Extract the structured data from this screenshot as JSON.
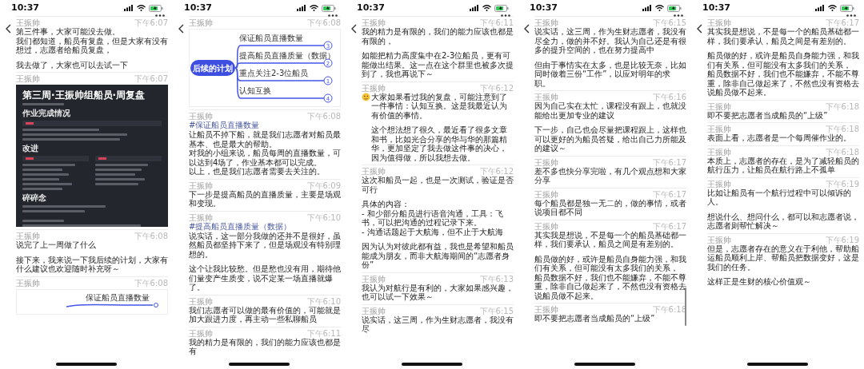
{
  "panels": [
    {
      "status": {
        "time": "10:37"
      },
      "messages": [
        {
          "kind": "text",
          "sender": "王振帅",
          "time": "下午6:07",
          "paragraphs": [
            [
              "第三件事，大家可能没去做。",
              "我们都知道，船员有复盘，但是大家有没有想过，志愿者给船员复盘，"
            ],
            [
              "我去做了，大家也可以去试一下"
            ]
          ]
        },
        {
          "kind": "document",
          "sender": "王振帅",
          "time": "下午6:07",
          "document": {
            "title": "第三周·王振帅组船员·周复盘",
            "sections": [
              {
                "heading": "作业完成情况",
                "kind": "single"
              },
              {
                "heading": "改进",
                "kind": "double"
              },
              {
                "heading": "碎碎念",
                "kind": "plain"
              }
            ]
          }
        },
        {
          "kind": "text",
          "sender": "王振帅",
          "time": "下午6:08",
          "paragraphs": [
            [
              "说完了上一周做了什么"
            ],
            [
              "接下来，我来说一下我后续的计划，大家有什么建议也欢迎随时补充呀～"
            ]
          ]
        },
        {
          "kind": "mindmap_preview",
          "sender": "王振帅",
          "time": "下午6:08",
          "label": "保证船员直播数量"
        }
      ]
    },
    {
      "status": {
        "time": "10:37"
      },
      "messages": [
        {
          "kind": "mindmap",
          "sender": "王振帅",
          "time": "下午6:08",
          "mindmap": {
            "center": "后续的计划",
            "branches": [
              {
                "label": "保证船员直播数量",
                "badge": "3"
              },
              {
                "label": "提高船员直播质量（数据）",
                "badge": "2"
              },
              {
                "label": "重点关注2-3位船员",
                "badge": "1"
              },
              {
                "label": "认知互换",
                "badge": "4"
              }
            ]
          }
        },
        {
          "kind": "topic",
          "sender": "王振帅",
          "time": "下午6:08",
          "hashtag": "#保证船员直播数量",
          "paragraphs": [
            [
              "让船员不掉下船，就是我们志愿者对船员最基本、也是最大的帮助。",
              "对我的小组来说，船员每周的直播数量，可以达到4场了，作业基本都可以完成。",
              "以上，也是我们志愿者需要去关注的。"
            ]
          ]
        },
        {
          "kind": "text",
          "sender": "王振帅",
          "time": "下午6:09",
          "paragraphs": [
            [
              "下一步是提高船员的直播质量，主要是场观和变现。"
            ]
          ]
        },
        {
          "kind": "topic",
          "sender": "王振帅",
          "time": "下午6:10",
          "hashtag": "#提高船员直播质量（数据）",
          "paragraphs": [
            [
              "说实话，这一部分我做的还并不是很好，虽然船员都坚持下来了，但是场观没有特别理想的。"
            ],
            [
              "这个让我比较愁。但是愁也没有用，期待他们量变产生质变，说不定某一场直播就爆了。"
            ]
          ]
        },
        {
          "kind": "text",
          "sender": "王振帅",
          "time": "下午6:10",
          "paragraphs": [
            [
              "我们志愿者可以做的最有价值的，可能就是加大跟进力度，再主动一些私聊船员"
            ]
          ]
        },
        {
          "kind": "text",
          "sender": "王振帅",
          "time": "下午6:11",
          "paragraphs": [
            [
              "我的精力是有限的，我们的能力应该也都是有"
            ]
          ]
        }
      ]
    },
    {
      "status": {
        "time": "10:37"
      },
      "messages": [
        {
          "kind": "text",
          "sender": "王振帅",
          "time": "下午6:11",
          "paragraphs": [
            [
              "我的精力是有限的，我们的能力应该也都是有限的，"
            ],
            [
              "如能把精力高度集中在2-3位船员，更有可能做出结果。这一点在这个群里也被多次提到了，我也再说下～"
            ]
          ]
        },
        {
          "kind": "text",
          "sender": "王振帅",
          "time": "下午6:12",
          "leading_emoji": true,
          "paragraphs": [
            [
              "大家如果看过我的复盘，可能注意到了一件事情：认知互换。这是我最近认为有价值的事情。"
            ],
            [
              "这个想法想了很久，最近看了很多文章和书，比如光合分享的华与华的那篇精华，更加坚定了我去做这件事的决心，因为值得做，所以我想去做。"
            ]
          ]
        },
        {
          "kind": "text",
          "sender": "王振帅",
          "time": "下午6:12",
          "paragraphs": [
            [
              "这次和船员一起，也是一次测试，验证是否可行"
            ],
            [
              "具体的内容：",
              "- 和少部分船员进行语音沟通，工具：飞书，可以把沟通的过程记录下来。",
              "- 沟通话题起于大航海，但不止于大航海"
            ],
            [
              "因为认为对彼此都有益，我也是希望和船员能成为朋友，而非大航海期间的“志愿者身份”"
            ]
          ]
        },
        {
          "kind": "text",
          "sender": "王振帅",
          "time": "下午6:13",
          "paragraphs": [
            [
              "我认为对航行是有利的，大家如果感兴趣，也可以试一下效果～"
            ]
          ]
        },
        {
          "kind": "text",
          "sender": "王振帅",
          "time": "下午6:15",
          "paragraphs": [
            [
              "说实话，这三周，作为生财志愿者，我没有尽"
            ]
          ]
        }
      ]
    },
    {
      "status": {
        "time": "10:37"
      },
      "show_scroll_indicator": true,
      "messages": [
        {
          "kind": "text",
          "sender": "王振帅",
          "time": "下午6:15",
          "paragraphs": [
            [
              "说实话，这三周，作为生财志愿者，我没有尽全力，做的并不好。我认为自己还是有很多的提升空间的，也在努力提高中"
            ],
            [
              "但由于事情实在太多，也是比较无奈，比如同时做着三份“工作”，以应对明年的求职。"
            ]
          ]
        },
        {
          "kind": "text",
          "sender": "王振帅",
          "time": "下午6:16",
          "paragraphs": [
            [
              "因为自己实在太忙，课程没有跟上，也就没能给出更加专业的建议"
            ],
            [
              "下一步，自己也会尽量把课程跟上，这样也可以更好的为船员答疑，给出自己力所能及的建议～"
            ]
          ]
        },
        {
          "kind": "text",
          "sender": "王振帅",
          "time": "下午6:17",
          "paragraphs": [
            [
              "差不多也快分享完啦，有几个观点想和大家分享"
            ]
          ]
        },
        {
          "kind": "text",
          "sender": "王振帅",
          "time": "下午6:17",
          "paragraphs": [
            [
              "每个船员都是独一无二的，做的事情，或者说项目都不同"
            ]
          ]
        },
        {
          "kind": "text",
          "sender": "王振帅",
          "time": "下午6:17",
          "paragraphs": [
            [
              "其实我是想说，不是每一个的船员基础都一样，我们要承认，船员之间是有差别的。"
            ],
            [
              "船员做的好，或许是船员自身能力强，和我们有关系，但可能没有太多我们的关系，",
              "船员数据不好，我们也不能嫌弃，不能不尊重，除非自己做起来了，不然也没有资格去说船员做不起来。"
            ]
          ]
        },
        {
          "kind": "text",
          "sender": "王振帅",
          "time": "下午6:18",
          "paragraphs": [
            [
              "即不要把志愿者当成船员的“上级”"
            ]
          ]
        }
      ]
    },
    {
      "status": {
        "time": "10:37"
      },
      "messages": [
        {
          "kind": "text",
          "sender": "王振帅",
          "time": "下午6:17",
          "paragraphs": [
            [
              "其实我是想说，不是每一个的船员基础都一样，我们要承认，船员之间是有差别的。"
            ],
            [
              "船员做的好，或许是船员自身能力强，和我们有关系，但可能没有太多我们的关系，",
              "船员数据不好，我们也不能嫌弃，不能不尊重，除非自己做起来了，不然也没有资格去说船员做不起来。"
            ]
          ]
        },
        {
          "kind": "text",
          "sender": "王振帅",
          "time": "下午6:18",
          "paragraphs": [
            [
              "即不要把志愿者当成船员的“上级”"
            ]
          ]
        },
        {
          "kind": "text",
          "sender": "王振帅",
          "time": "下午6:18",
          "paragraphs": [
            [
              "表面上看，志愿者是一个每周催作业的。"
            ]
          ]
        },
        {
          "kind": "text",
          "sender": "王振帅",
          "time": "下午6:18",
          "paragraphs": [
            [
              "本质上，志愿者的存在，是为了减轻船员的航行压力，让船员在航行路上不孤单"
            ]
          ]
        },
        {
          "kind": "text",
          "sender": "王振帅",
          "time": "下午6:19",
          "paragraphs": [
            [
              "比如让船员有一个航行过程中可以倾诉的人。"
            ],
            [
              "想说什么、想问什么，都可以和志愿者说，志愿者则帮忙解决～"
            ]
          ]
        },
        {
          "kind": "text",
          "sender": "王振帅",
          "time": "下午6:19",
          "paragraphs": [
            [
              "但是，志愿者存在的意义在于利他，帮助船运船员顺利上岸、帮船员把数据变好，这是我们的任务。"
            ],
            [
              "这样正是生财的核心价值观～"
            ]
          ]
        }
      ]
    }
  ]
}
